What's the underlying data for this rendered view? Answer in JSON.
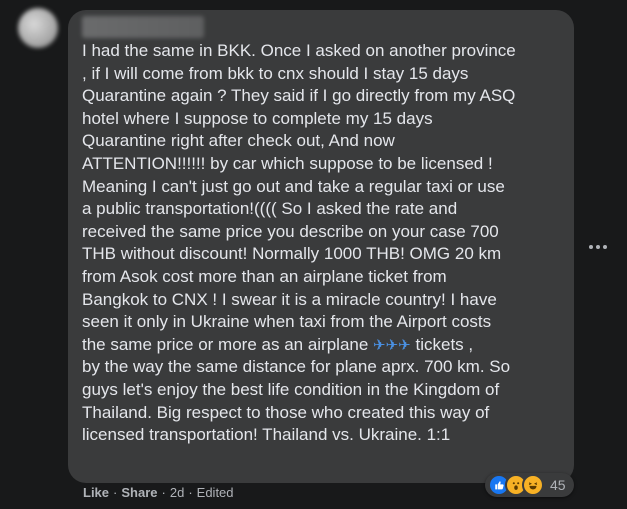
{
  "comment": {
    "text_part1": "I had the same in BKK. Once I asked on another province\n, if I will come from bkk to cnx should I stay 15 days\nQuarantine again ? They said if I go directly from my ASQ\nhotel where I suppose to complete my 15 days\nQuarantine right after check out, And now\nATTENTION!!!!!! by car which suppose to be licensed !\nMeaning I can't just go out and take a regular taxi or use\na public transportation!(((( So I asked the rate and\nreceived the same price you describe on your case 700\nTHB without discount! Normally 1000 THB! OMG 20 km\nfrom Asok cost more than an airplane ticket from\nBangkok to CNX ! I swear it is a miracle country! I have\nseen it only in Ukraine when taxi from the Airport costs\nthe same price or more as an airplane ",
    "plane_emojis": "✈✈✈",
    "text_part2": " tickets ,\n by the way the same distance for plane aprx. 700 km. So\nguys let's enjoy the best life condition in the Kingdom of\nThailand. Big respect to those who created this way of\nlicensed transportation! Thailand vs. Ukraine. 1:1"
  },
  "actions": {
    "like": "Like",
    "share": "Share",
    "time": "2d",
    "edited": "Edited",
    "separator": "·"
  },
  "reactions": {
    "count": "45",
    "types": [
      "like-icon",
      "wow-icon",
      "haha-icon"
    ]
  },
  "colors": {
    "background": "#18191a",
    "bubble": "#3a3b3c",
    "text": "#e4e6eb",
    "secondary_text": "#b0b3b8",
    "like_blue": "#1877f2",
    "emoji_yellow": "#f7b125"
  }
}
